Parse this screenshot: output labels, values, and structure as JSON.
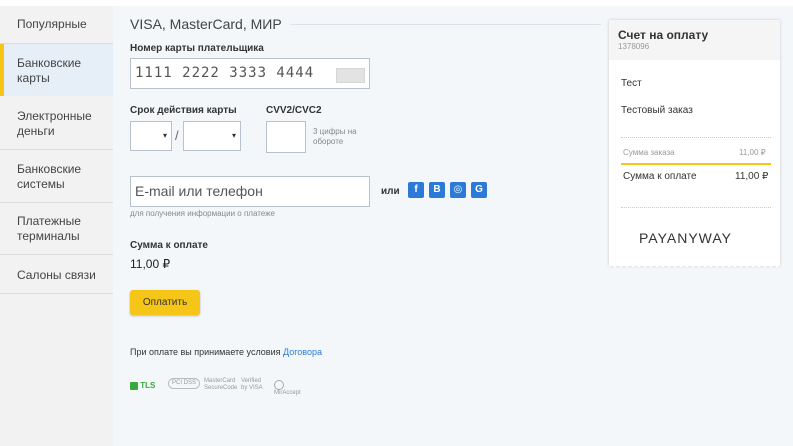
{
  "sidebar": {
    "items": [
      {
        "label": "Популярные"
      },
      {
        "label": "Банковские карты"
      },
      {
        "label": "Электронные деньги"
      },
      {
        "label": "Банковские системы"
      },
      {
        "label": "Платежные терминалы"
      },
      {
        "label": "Салоны связи"
      }
    ]
  },
  "form": {
    "methods_title": "VISA, MasterCard, МИР",
    "card_number_label": "Номер карты плательщика",
    "card_number_value": "1111 2222 3333 4444",
    "expiry_label": "Срок действия карты",
    "expiry_month": "▾",
    "expiry_sep": "/",
    "expiry_year": "▾",
    "cvv_label": "CVV2/CVC2",
    "cvv_hint": "3 цифры на обороте",
    "email_placeholder": "E-mail или телефон",
    "or_label": "или",
    "email_hint": "для получения информации о платеже",
    "social": [
      "f",
      "B",
      "◎",
      "G"
    ],
    "amount_label": "Сумма к оплате",
    "amount_value": "11,00 ₽",
    "pay_button": "Оплатить",
    "terms_text": "При оплате вы принимаете условия",
    "terms_link": "Договора",
    "badges": {
      "tls": "TLS",
      "pcidss": "PCI DSS",
      "mc": "MasterCard SecureCode",
      "visa": "Verified by VISA",
      "mir": "MirAccept"
    }
  },
  "invoice": {
    "title": "Счет на оплату",
    "id": "1378096",
    "shop": "Тест",
    "order": "Тестовый заказ",
    "order_sum_label": "Сумма заказа",
    "order_sum_value": "11,00 ₽",
    "total_label": "Сумма к оплате",
    "total_value": "11,00 ₽",
    "brand": "PAYANYWAY"
  },
  "colors": {
    "accent": "#f5c518",
    "link": "#2d7ad6",
    "tls": "#3aa83a"
  }
}
